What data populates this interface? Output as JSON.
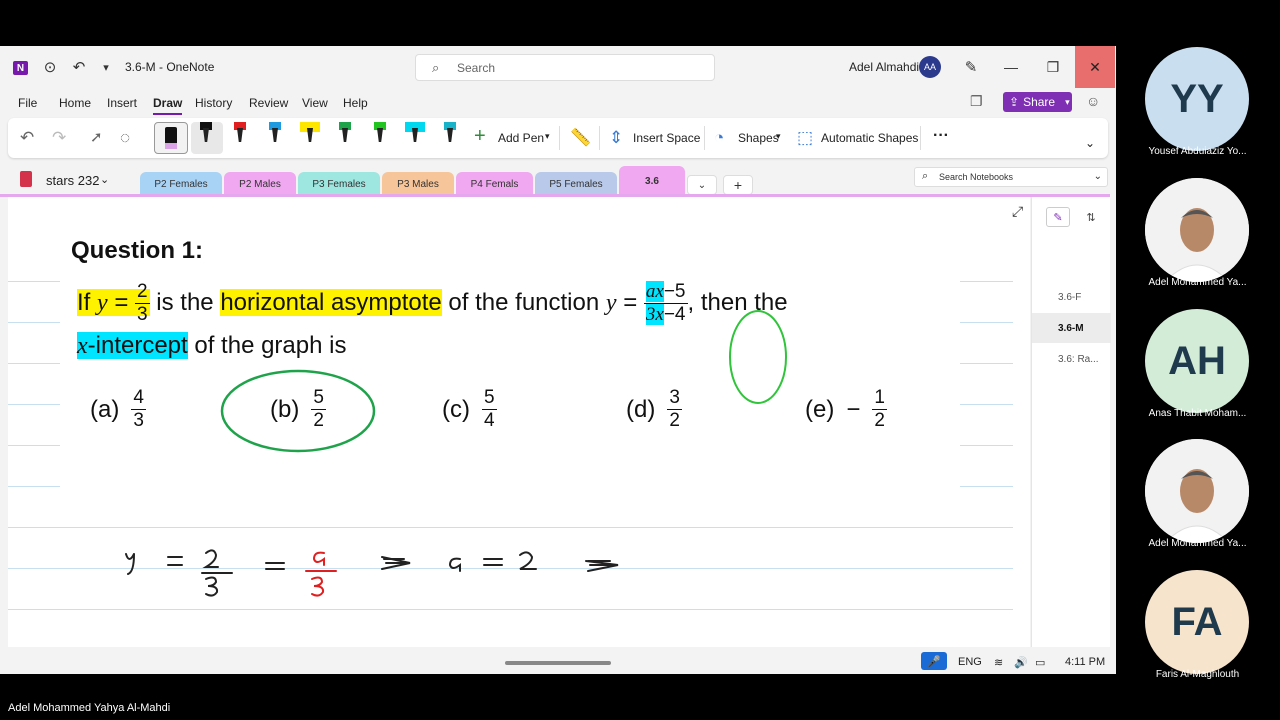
{
  "window": {
    "title": "3.6-M  -  OneNote",
    "search_placeholder": "Search",
    "user_name": "Adel Almahdi",
    "user_initials": "AA"
  },
  "menu": [
    "File",
    "Home",
    "Insert",
    "Draw",
    "History",
    "Review",
    "View",
    "Help"
  ],
  "menu_active": "Draw",
  "share_label": "Share",
  "ribbon": {
    "add_pen": "Add Pen",
    "insert_space": "Insert Space",
    "shapes": "Shapes",
    "automatic_shapes": "Automatic Shapes",
    "more": "···"
  },
  "notebook": {
    "name": "stars 232"
  },
  "section_tabs": [
    {
      "label": "P2 Females",
      "color": "#a9d3f5"
    },
    {
      "label": "P2 Males",
      "color": "#f0a8f0"
    },
    {
      "label": "P3 Females",
      "color": "#9ee6e0"
    },
    {
      "label": "P3 Males",
      "color": "#f7c59a"
    },
    {
      "label": "P4 Femals",
      "color": "#f0a8f0"
    },
    {
      "label": "P5 Females",
      "color": "#b9c9ea"
    },
    {
      "label": "3.6",
      "color": "#f0a8f0"
    }
  ],
  "search_notebooks": "Search Notebooks",
  "question": {
    "title": "Question 1:",
    "line1_if": "If",
    "line1_y": "y",
    "line1_eq": " = ",
    "line1_frac_num": "2",
    "line1_frac_den": "3",
    "line1_is_the": " is the ",
    "line1_hl": "horizontal asymptote",
    "line1_of": " of the function ",
    "line1_fy": "y",
    "line1_feq": " = ",
    "line1_ax": "ax",
    "line1_minus5": "−5",
    "line1_3x": "3x",
    "line1_minus4": "−4",
    "line1_then": ", then the",
    "line2_x": "x",
    "line2_intercept": "-intercept",
    "line2_rest": " of the graph is"
  },
  "choices": [
    {
      "label": "(a)",
      "num": "4",
      "den": "3",
      "neg": ""
    },
    {
      "label": "(b)",
      "num": "5",
      "den": "2",
      "neg": ""
    },
    {
      "label": "(c)",
      "num": "5",
      "den": "4",
      "neg": ""
    },
    {
      "label": "(d)",
      "num": "3",
      "den": "2",
      "neg": ""
    },
    {
      "label": "(e)",
      "num": "1",
      "den": "2",
      "neg": "−"
    }
  ],
  "pages": [
    "3.6-F",
    "3.6-M",
    "3.6: Ra..."
  ],
  "selected_page": "3.6-M",
  "status": {
    "lang": "ENG",
    "time": "4:11 PM"
  },
  "participants": [
    {
      "initials": "YY",
      "name": "Yousef Abduiaziz Yo...",
      "color": "#c9dff0"
    },
    {
      "initials": "",
      "name": "Adel Mohammed Ya...",
      "color": "#f4f4f4"
    },
    {
      "initials": "AH",
      "name": "Anas Thabit Moham...",
      "color": "#d3ecd8"
    },
    {
      "initials": "",
      "name": "Adel Mohammed Ya...",
      "color": "#f4f4f4"
    },
    {
      "initials": "FA",
      "name": "Faris Al-Maghlouth",
      "color": "#f7e4cc"
    }
  ],
  "presenter_name": "Adel Mohammed Yahya Al-Mahdi"
}
